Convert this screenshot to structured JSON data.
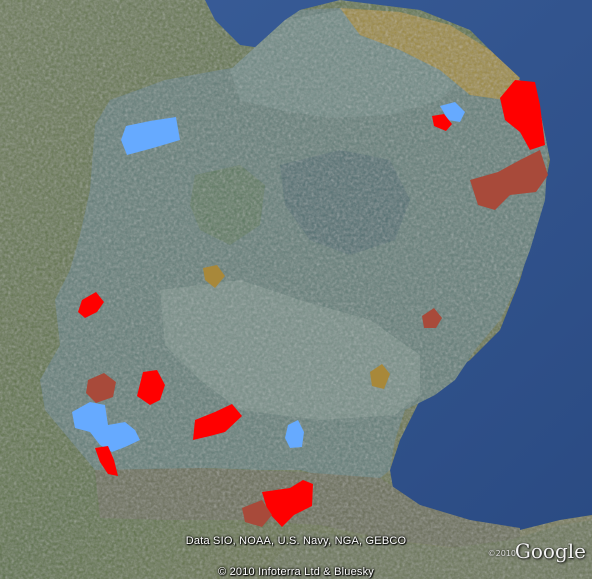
{
  "attribution": {
    "data_sources": "Data SIO, NOAA, U.S. Navy, NGA, GEBCO",
    "copyright": "© 2010 Infoterra Ltd & Bluesky"
  },
  "logo": {
    "prefix": "©2010",
    "text": "Google"
  },
  "colors": {
    "sea": "#2f4f86",
    "land_far": "#6b7f63",
    "region_base": "#617f78",
    "region_light": "#7c9590",
    "coast_yellow": "#9a8a3a",
    "red": "#ff0000",
    "dark_red": "#a84a3a",
    "light_blue": "#66aaff",
    "tan": "#a8883a"
  },
  "legend_note": "",
  "polygon_categories": [
    "red",
    "dark-red",
    "light-blue",
    "tan"
  ]
}
